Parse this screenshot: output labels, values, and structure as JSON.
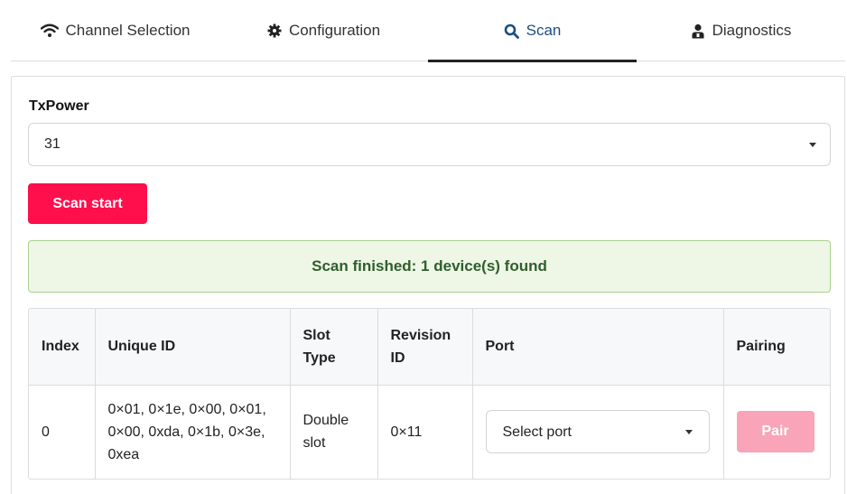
{
  "tabs": [
    {
      "label": "Channel Selection",
      "icon": "wifi-icon",
      "active": false
    },
    {
      "label": "Configuration",
      "icon": "gear-icon",
      "active": false
    },
    {
      "label": "Scan",
      "icon": "search-icon",
      "active": true
    },
    {
      "label": "Diagnostics",
      "icon": "user-icon",
      "active": false
    }
  ],
  "txpower": {
    "label": "TxPower",
    "value": "31"
  },
  "scan_button": {
    "label": "Scan start"
  },
  "alert": {
    "message": "Scan finished: 1 device(s) found"
  },
  "table": {
    "headers": [
      "Index",
      "Unique ID",
      "Slot Type",
      "Revision ID",
      "Port",
      "Pairing"
    ],
    "rows": [
      {
        "index": "0",
        "unique_id": "0×01, 0×1e, 0×00, 0×01, 0×00, 0xda, 0×1b, 0×3e, 0xea",
        "slot_type": "Double slot",
        "revision_id": "0×11",
        "port_placeholder": "Select port",
        "pair_label": "Pair"
      }
    ]
  },
  "colors": {
    "accent": "#ff0f4b",
    "pair_disabled": "#f9a4b8",
    "alert_bg": "#eef6e6",
    "alert_border": "#a9d08e",
    "alert_text": "#2f5f2c",
    "active_tab": "#1c4e80"
  }
}
